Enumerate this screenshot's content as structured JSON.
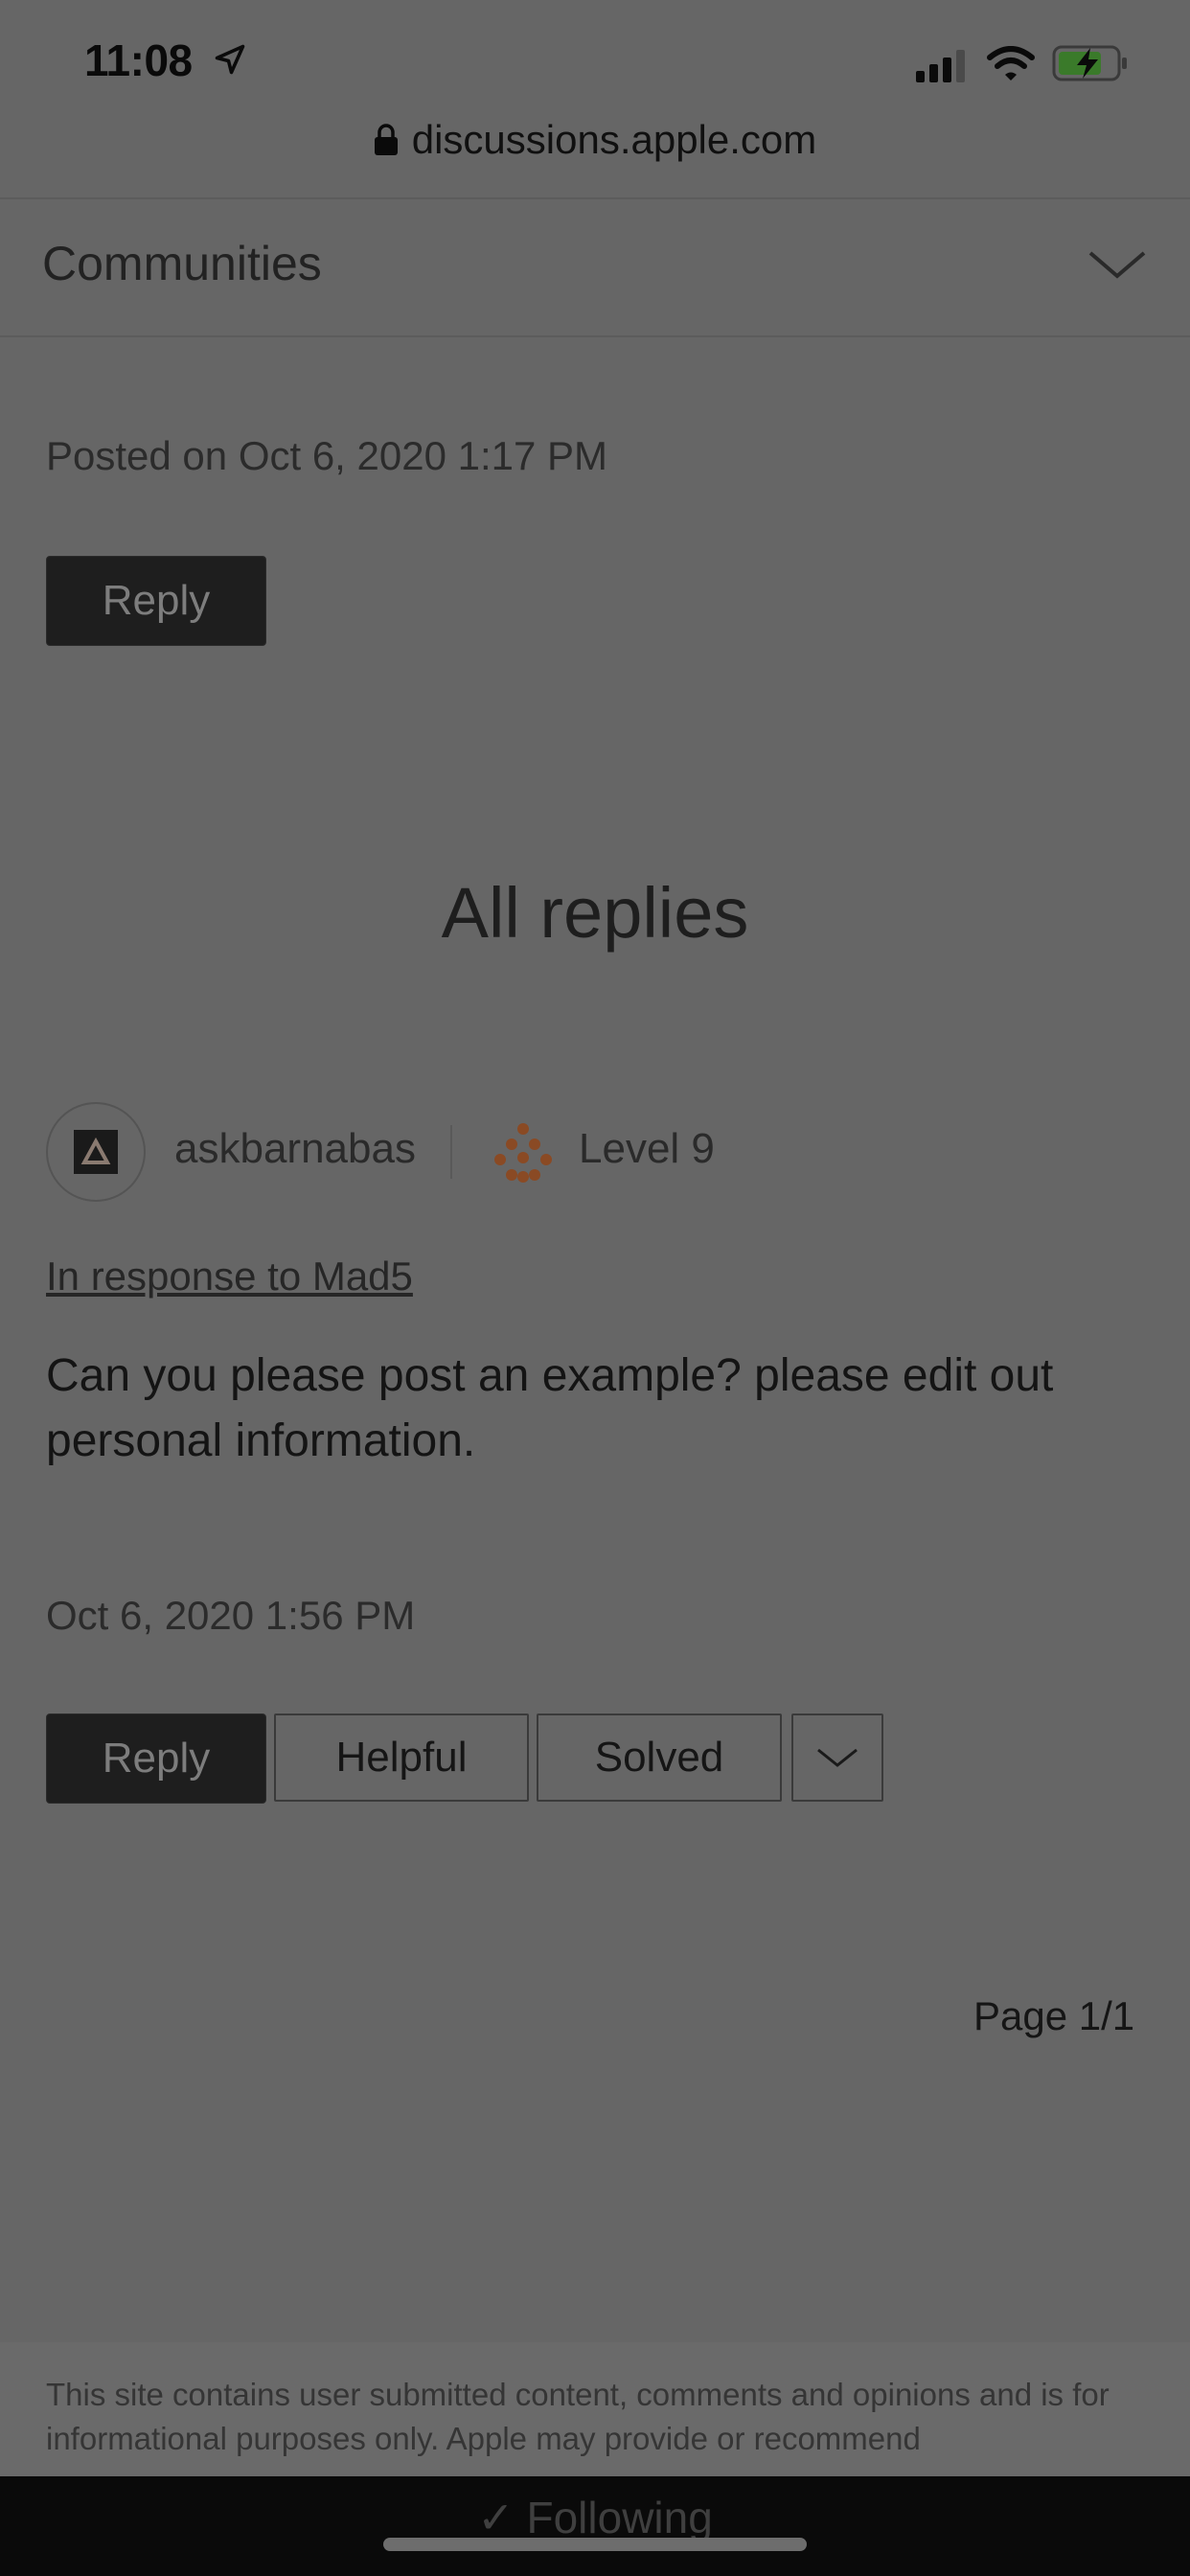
{
  "status_bar": {
    "time": "11:08",
    "icons": [
      "location-arrow-icon",
      "cellular-signal-icon",
      "wifi-icon",
      "battery-charging-icon"
    ]
  },
  "browser": {
    "url": "discussions.apple.com",
    "icons": [
      "lock-icon"
    ]
  },
  "nav": {
    "communities_label": "Communities",
    "icons": [
      "chevron-down-icon"
    ]
  },
  "original_post": {
    "posted_on": "Posted on Oct 6, 2020 1:17 PM",
    "reply_label": "Reply"
  },
  "replies": {
    "heading": "All replies",
    "items": [
      {
        "username": "askbarnabas",
        "level": "Level 9",
        "in_response_to": "In response to Mad5",
        "body": "Can you please post an example? please edit out personal information.",
        "date": "Oct 6, 2020 1:56 PM",
        "actions": {
          "reply": "Reply",
          "helpful": "Helpful",
          "solved": "Solved"
        }
      }
    ]
  },
  "pagination": {
    "page_label": "Page 1/1"
  },
  "footer": {
    "disclaimer": "This site contains user submitted content, comments and opinions and is for informational purposes only. Apple may provide or recommend"
  },
  "follow_bar": {
    "label": "✓ Following"
  },
  "colors": {
    "page_bg": "#666666",
    "dark_button": "#1e1e1e",
    "level_dots": "#8a4a24",
    "battery_charge": "#3a7a2a"
  }
}
